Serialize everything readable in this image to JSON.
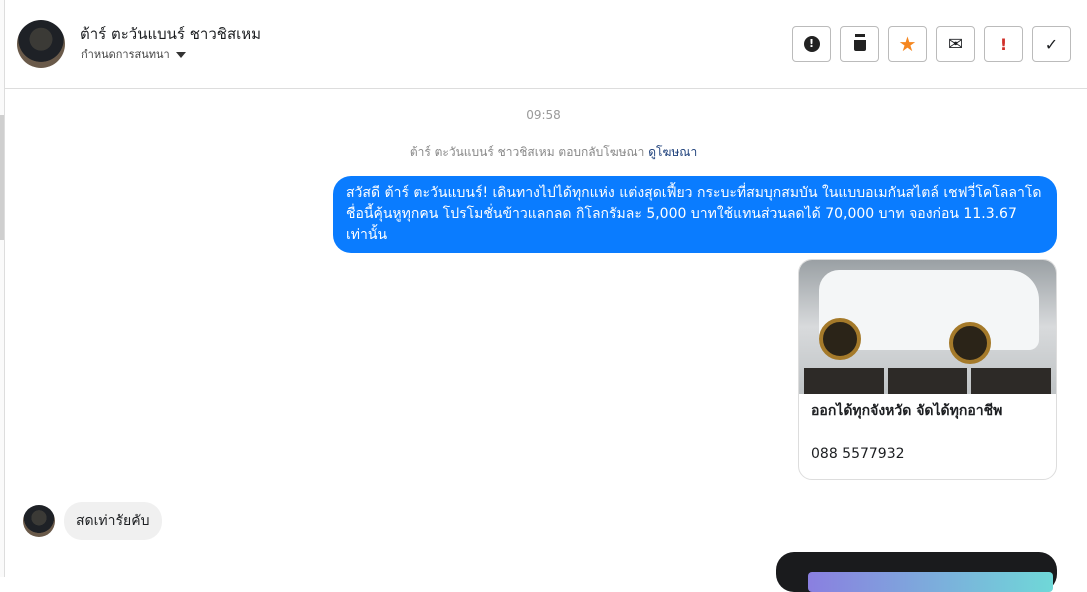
{
  "header": {
    "name": "ต้าร์ ตะวันแบนร์ ชาวชิสเหม",
    "subtitle": "กำหนดการสนทนา",
    "actions": [
      {
        "icon": "exclamation-circle-icon",
        "glyph": "❗"
      },
      {
        "icon": "trash-icon",
        "glyph": "🗑"
      },
      {
        "icon": "star-icon",
        "glyph": "★",
        "color": "#f5861f"
      },
      {
        "icon": "envelope-icon",
        "glyph": "✉"
      },
      {
        "icon": "exclamation-icon",
        "glyph": "!",
        "color": "#d0302a"
      },
      {
        "icon": "check-icon",
        "glyph": "✓"
      }
    ]
  },
  "chat": {
    "timestamp": "09:58",
    "reply_note": "ต้าร์ ตะวันแบนร์ ชาวชิสเหม ตอบกลับโฆษณา",
    "view_ad_link": "ดูโฆษณา",
    "outgoing_message": "สวัสดี ต้าร์ ตะวันแบนร์! เดินทางไปได้ทุกแห่ง แต่งสุดเฟี้ยว กระบะที่สมบุกสมบัน ในแบบอเมกันสไตล์ เชฟวี่โคโลลาโด ชื่อนี้คุ้นหูทุกคน โปรโมชั่นข้าวแลกลด กิโลกรัมละ 5,000 บาทใช้แทนส่วนลดได้ 70,000 บาท จองก่อน 11.3.67 เท่านั้น",
    "ad_card": {
      "title": "ออกได้ทุกจังหวัด จัดได้ทุกอาชีพ",
      "phone": "088 5577932"
    },
    "incoming_message": "สดเท่ารัยคับ"
  },
  "colors": {
    "accent": "#0a7cff"
  }
}
